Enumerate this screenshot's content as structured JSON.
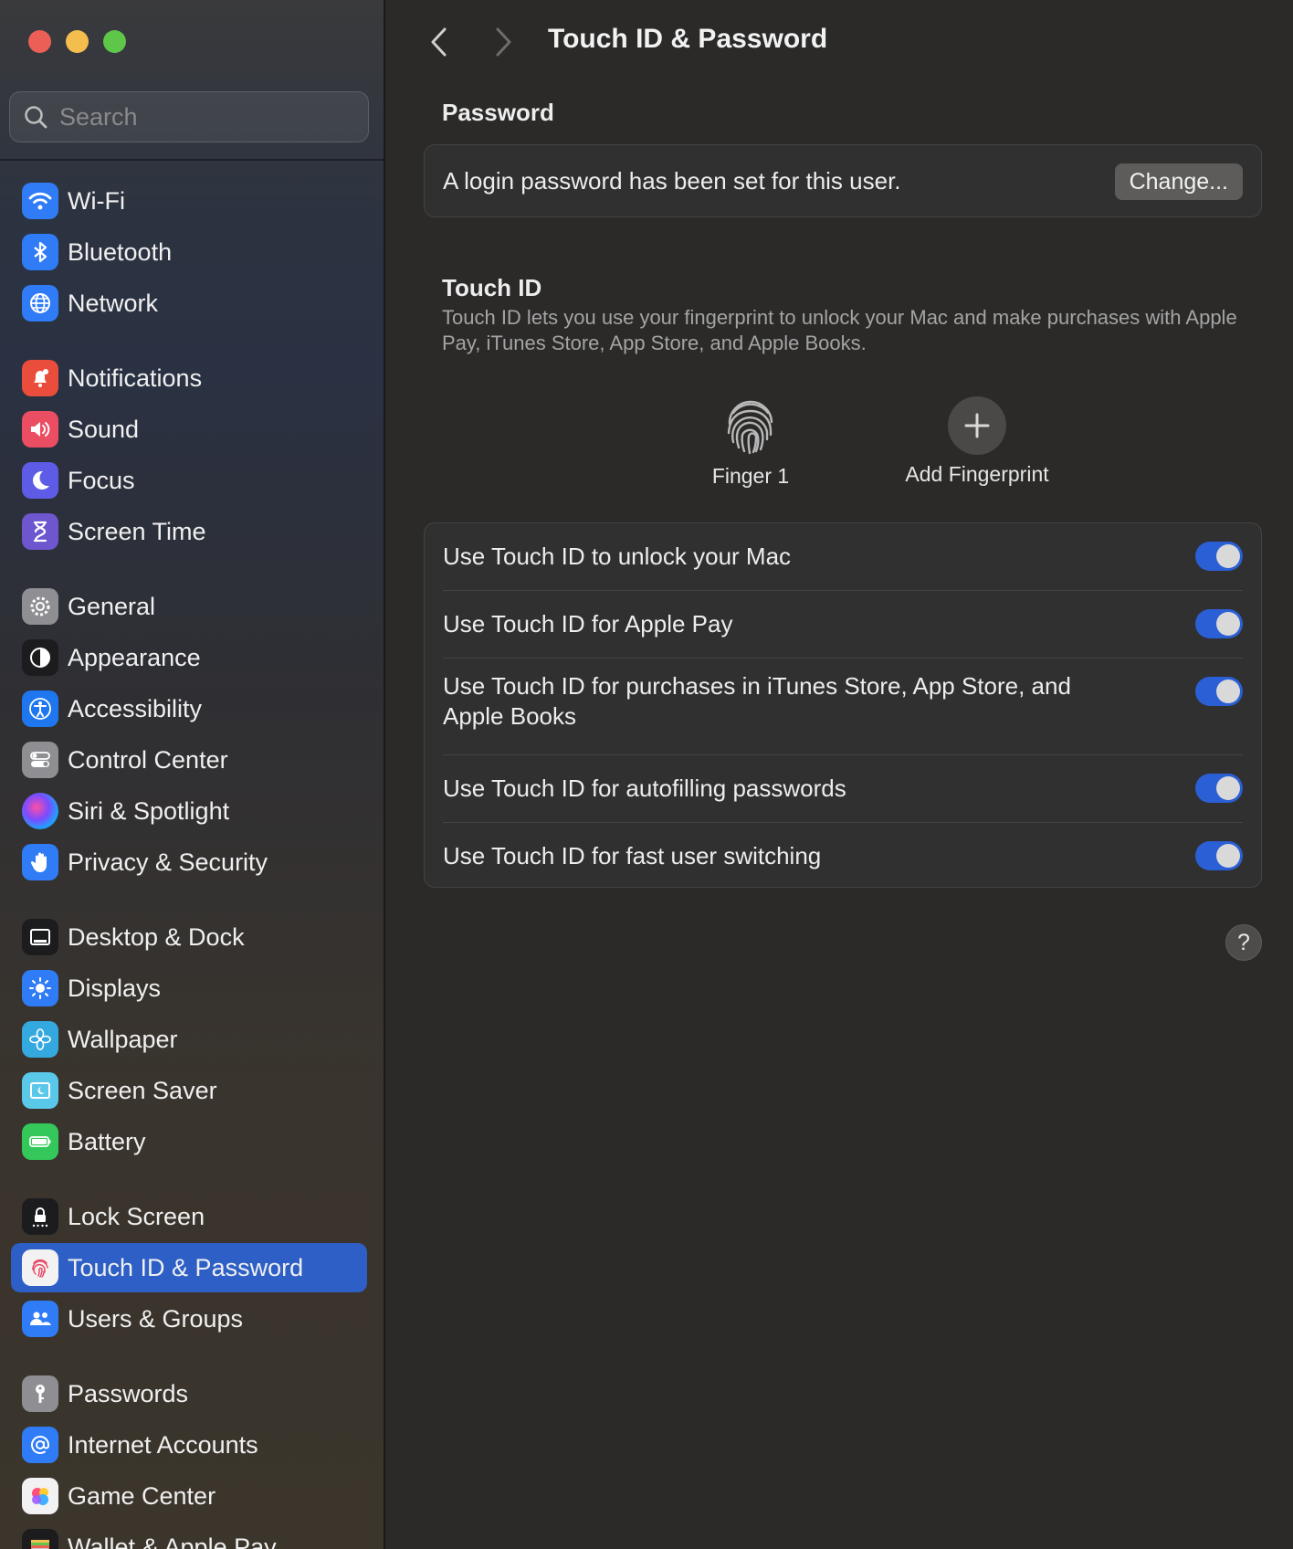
{
  "window": {
    "title": "Touch ID & Password"
  },
  "search": {
    "placeholder": "Search"
  },
  "sidebar": {
    "items": [
      {
        "label": "Wi-Fi",
        "icon": "wifi-icon",
        "color": "#2f7cf6"
      },
      {
        "label": "Bluetooth",
        "icon": "bluetooth-icon",
        "color": "#2f7cf6"
      },
      {
        "label": "Network",
        "icon": "globe-icon",
        "color": "#2f7cf6"
      },
      {
        "label": "Notifications",
        "icon": "bell-icon",
        "color": "#eb4d3d"
      },
      {
        "label": "Sound",
        "icon": "speaker-icon",
        "color": "#eb4d62"
      },
      {
        "label": "Focus",
        "icon": "moon-icon",
        "color": "#5e5ce6"
      },
      {
        "label": "Screen Time",
        "icon": "hourglass-icon",
        "color": "#6e56cf"
      },
      {
        "label": "General",
        "icon": "gear-icon",
        "color": "#8e8e93"
      },
      {
        "label": "Appearance",
        "icon": "appearance-icon",
        "color": "#1c1c1e"
      },
      {
        "label": "Accessibility",
        "icon": "accessibility-icon",
        "color": "#1f77f0"
      },
      {
        "label": "Control Center",
        "icon": "control-center-icon",
        "color": "#8e8e93"
      },
      {
        "label": "Siri & Spotlight",
        "icon": "siri-icon",
        "color": "#2b2b4a"
      },
      {
        "label": "Privacy & Security",
        "icon": "hand-icon",
        "color": "#2f7cf6"
      },
      {
        "label": "Desktop & Dock",
        "icon": "dock-icon",
        "color": "#1c1c1e"
      },
      {
        "label": "Displays",
        "icon": "sun-icon",
        "color": "#2f7cf6"
      },
      {
        "label": "Wallpaper",
        "icon": "flower-icon",
        "color": "#34a9e0"
      },
      {
        "label": "Screen Saver",
        "icon": "screen-saver-icon",
        "color": "#5ac8e8"
      },
      {
        "label": "Battery",
        "icon": "battery-icon",
        "color": "#34c759"
      },
      {
        "label": "Lock Screen",
        "icon": "lock-icon",
        "color": "#1c1c1e"
      },
      {
        "label": "Touch ID & Password",
        "icon": "fingerprint-icon",
        "color": "#f2f2f2",
        "selected": true
      },
      {
        "label": "Users & Groups",
        "icon": "users-icon",
        "color": "#2f7cf6"
      },
      {
        "label": "Passwords",
        "icon": "key-icon",
        "color": "#8e8e93"
      },
      {
        "label": "Internet Accounts",
        "icon": "at-icon",
        "color": "#2f7cf6"
      },
      {
        "label": "Game Center",
        "icon": "game-center-icon",
        "color": "#f2f2f2"
      },
      {
        "label": "Wallet & Apple Pay",
        "icon": "wallet-icon",
        "color": "#1c1c1e"
      }
    ]
  },
  "main": {
    "title": "Touch ID & Password",
    "password": {
      "heading": "Password",
      "status": "A login password has been set for this user.",
      "change_label": "Change..."
    },
    "touch_id": {
      "heading": "Touch ID",
      "description": "Touch ID lets you use your fingerprint to unlock your Mac and make purchases with Apple Pay, iTunes Store, App Store, and Apple Books.",
      "fingers": {
        "finger1": "Finger 1",
        "add": "Add Fingerprint"
      },
      "options": [
        {
          "label": "Use Touch ID to unlock your Mac",
          "on": true
        },
        {
          "label": "Use Touch ID for Apple Pay",
          "on": true
        },
        {
          "label": "Use Touch ID for purchases in iTunes Store, App Store, and Apple Books",
          "on": true
        },
        {
          "label": "Use Touch ID for autofilling passwords",
          "on": true
        },
        {
          "label": "Use Touch ID for fast user switching",
          "on": true
        }
      ]
    },
    "help_label": "?"
  }
}
